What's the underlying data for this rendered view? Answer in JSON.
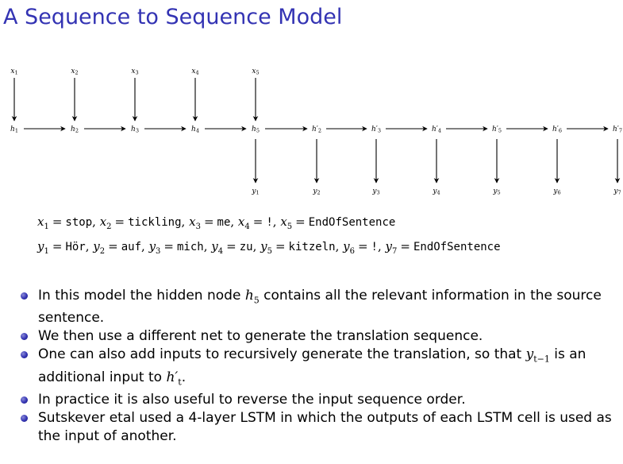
{
  "title": "A Sequence to Sequence Model",
  "diagram": {
    "inputs": [
      {
        "base": "x",
        "sub": "1"
      },
      {
        "base": "x",
        "sub": "2"
      },
      {
        "base": "x",
        "sub": "3"
      },
      {
        "base": "x",
        "sub": "4"
      },
      {
        "base": "x",
        "sub": "5"
      }
    ],
    "hidden": [
      {
        "base": "h",
        "prime": "",
        "sub": "1"
      },
      {
        "base": "h",
        "prime": "",
        "sub": "2"
      },
      {
        "base": "h",
        "prime": "",
        "sub": "3"
      },
      {
        "base": "h",
        "prime": "",
        "sub": "4"
      },
      {
        "base": "h",
        "prime": "",
        "sub": "5"
      },
      {
        "base": "h",
        "prime": "′",
        "sub": "2"
      },
      {
        "base": "h",
        "prime": "′",
        "sub": "3"
      },
      {
        "base": "h",
        "prime": "′",
        "sub": "4"
      },
      {
        "base": "h",
        "prime": "′",
        "sub": "5"
      },
      {
        "base": "h",
        "prime": "′",
        "sub": "6"
      },
      {
        "base": "h",
        "prime": "′",
        "sub": "7"
      }
    ],
    "outputs": [
      {
        "base": "y",
        "sub": "1"
      },
      {
        "base": "y",
        "sub": "2"
      },
      {
        "base": "y",
        "sub": "3"
      },
      {
        "base": "y",
        "sub": "4"
      },
      {
        "base": "y",
        "sub": "5"
      },
      {
        "base": "y",
        "sub": "6"
      },
      {
        "base": "y",
        "sub": "7"
      }
    ]
  },
  "source_assignments": [
    {
      "var": "x",
      "sub": "1",
      "value": "stop"
    },
    {
      "var": "x",
      "sub": "2",
      "value": "tickling"
    },
    {
      "var": "x",
      "sub": "3",
      "value": "me"
    },
    {
      "var": "x",
      "sub": "4",
      "value": "!"
    },
    {
      "var": "x",
      "sub": "5",
      "value": "EndOfSentence"
    }
  ],
  "target_assignments": [
    {
      "var": "y",
      "sub": "1",
      "value": "Hör"
    },
    {
      "var": "y",
      "sub": "2",
      "value": "auf"
    },
    {
      "var": "y",
      "sub": "3",
      "value": "mich"
    },
    {
      "var": "y",
      "sub": "4",
      "value": "zu"
    },
    {
      "var": "y",
      "sub": "5",
      "value": "kitzeln"
    },
    {
      "var": "y",
      "sub": "6",
      "value": "!"
    },
    {
      "var": "y",
      "sub": "7",
      "value": "EndOfSentence"
    }
  ],
  "bullets": {
    "b1": {
      "pre": "In this model the hidden node ",
      "m_base": "h",
      "m_sub": "5",
      "post": " contains all the relevant information in the source sentence."
    },
    "b2": {
      "text": "We then use a different net to generate the translation sequence."
    },
    "b3": {
      "pre": "One can also add inputs to recursively generate the translation, so that ",
      "m1_base": "y",
      "m1_sub": "t−1",
      "mid": " is an additional input to ",
      "m2_base": "h",
      "m2_prime": "′",
      "m2_sub": "t",
      "post": "."
    },
    "b4": {
      "text": "In practice it is also useful to reverse the input sequence order."
    },
    "b5": {
      "text": "Sutskever etal used a 4-layer LSTM in which the outputs of each LSTM cell is used as the input of another."
    }
  },
  "colors": {
    "title": "#3333b3",
    "bullet": "#3333b3",
    "text": "#000000"
  }
}
